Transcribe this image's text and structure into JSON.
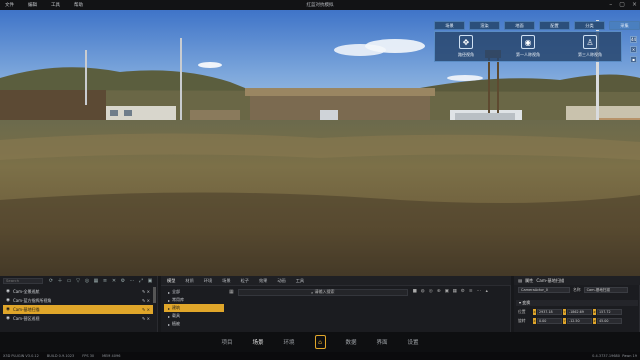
{
  "menu": {
    "items": [
      "文件",
      "编辑",
      "工具",
      "帮助"
    ]
  },
  "window": {
    "title": "红蓝对抗模拟"
  },
  "viewport": {
    "toolbar": [
      "场景",
      "渲染",
      "地面",
      "配置",
      "分类",
      "采集"
    ],
    "active_tab": "采集",
    "tools": [
      {
        "label": "路径视角",
        "icon": "move-icon"
      },
      {
        "label": "第一人称视角",
        "icon": "camera-icon"
      },
      {
        "label": "第三人称视角",
        "icon": "person-icon"
      }
    ],
    "badge": "44"
  },
  "left_panel": {
    "search_placeholder": "Search",
    "items": [
      {
        "label": "Cam-全景巡航",
        "selected": false
      },
      {
        "label": "Cam-蓝方指挥所视角",
        "selected": false
      },
      {
        "label": "Cam-基地扫描",
        "selected": true
      },
      {
        "label": "Cam-营区巡视",
        "selected": false
      }
    ]
  },
  "mid_panel": {
    "tabs": [
      "模型",
      "材质",
      "环境",
      "场景",
      "粒子",
      "效果",
      "动画",
      "工具"
    ],
    "active_tab": "模型",
    "categories": [
      "全部",
      "常用库",
      "建筑",
      "载具",
      "植被"
    ],
    "selected_category": "建筑",
    "search_placeholder": "请输入搜索"
  },
  "right_panel": {
    "title": "属性",
    "name_label": "名称",
    "name_value": "Cam-基地扫描",
    "id_value": "CameraActor_0",
    "section": "变换",
    "rows": [
      {
        "label": "位置",
        "x": "2937.18",
        "y": "-1862.69",
        "z": "157.72"
      },
      {
        "label": "旋转",
        "x": "0.00",
        "y": "-12.50",
        "z": "45.00"
      }
    ]
  },
  "bottom_nav": {
    "items": [
      "项目",
      "场景",
      "环境",
      "",
      "数据",
      "界面",
      "设置"
    ],
    "active": "场景"
  },
  "status": {
    "left": "X3D PLUGIN V3.0.12",
    "build": "BUILD 0.9.1023",
    "fps": "FPS 30",
    "mem": "MEM 4096",
    "right": "0.4.3737.19680",
    "tag": "Pawn 19"
  }
}
